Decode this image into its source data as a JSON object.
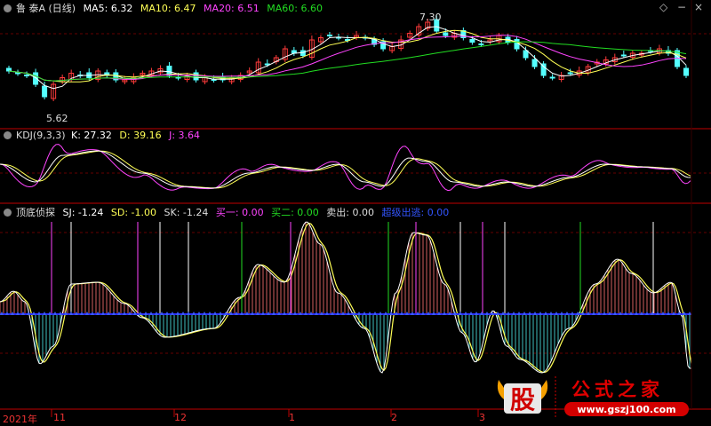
{
  "main_header": {
    "symbol": "鲁 泰A (日线)",
    "ma5": "MA5: 6.32",
    "ma10": "MA10: 6.47",
    "ma20": "MA20: 6.51",
    "ma60": "MA60: 6.60"
  },
  "kdj_header": {
    "name": "KDJ(9,3,3)",
    "k": "K: 27.32",
    "d": "D: 39.16",
    "j": "J: 3.64"
  },
  "detect_header": {
    "name": "顶底侦探",
    "sj": "SJ: -1.24",
    "sd": "SD: -1.00",
    "sk": "SK: -1.24",
    "buy1": "买一: 0.00",
    "buy2": "买二: 0.00",
    "sell": "卖出: 0.00",
    "escape": "超级出逃: 0.00"
  },
  "annotations": {
    "high": "7.30",
    "low": "5.62"
  },
  "x_axis": [
    "2021年",
    "11",
    "12",
    "1",
    "2",
    "3"
  ],
  "controls": {
    "diamond": "◇",
    "minus": "−",
    "close": "×"
  },
  "colors": {
    "up": "#ff3b3b",
    "down": "#54ffff",
    "ma5": "#ffffff",
    "ma10": "#ffff55",
    "ma20": "#ff44ff",
    "ma60": "#22dd22",
    "k": "#ffffff",
    "d": "#ffff55",
    "j": "#ff44ff",
    "border": "#c00000",
    "zero": "#2a2aff"
  },
  "logo": {
    "text1": "股",
    "text2": "公式之家",
    "url": "www.gszj100.com"
  },
  "chart_data": [
    {
      "type": "candlestick",
      "title": "鲁泰A (日线)",
      "series_names": [
        "MA5",
        "MA10",
        "MA20",
        "MA60"
      ],
      "ylim": [
        5.2,
        7.5
      ],
      "high_mark": 7.3,
      "low_mark": 5.62,
      "close_path": [
        6.2,
        6.15,
        6.1,
        5.9,
        5.62,
        5.9,
        6.05,
        6.15,
        6.1,
        6.05,
        6.2,
        6.1,
        6.0,
        6.0,
        6.05,
        6.15,
        6.2,
        6.25,
        6.1,
        6.05,
        6.1,
        6.0,
        6.05,
        6.0,
        6.0,
        6.05,
        6.1,
        6.2,
        6.4,
        6.35,
        6.5,
        6.7,
        6.6,
        6.55,
        6.9,
        6.95,
        7.0,
        6.95,
        6.9,
        7.0,
        6.95,
        6.8,
        6.7,
        6.75,
        6.9,
        7.05,
        7.2,
        7.3,
        7.1,
        7.0,
        7.05,
        6.95,
        6.85,
        6.8,
        6.9,
        7.0,
        6.85,
        6.7,
        6.5,
        6.3,
        6.1,
        6.05,
        6.1,
        6.15,
        6.2,
        6.3,
        6.4,
        6.45,
        6.5,
        6.55,
        6.6,
        6.6,
        6.65,
        6.7,
        6.6,
        6.3,
        6.1
      ]
    },
    {
      "type": "line",
      "title": "KDJ(9,3,3)",
      "series": [
        {
          "name": "K",
          "last": 27.32
        },
        {
          "name": "D",
          "last": 39.16
        },
        {
          "name": "J",
          "last": 3.64
        }
      ]
    },
    {
      "type": "bar",
      "title": "顶底侦探",
      "series": [
        {
          "name": "SJ",
          "last": -1.24
        },
        {
          "name": "SD",
          "last": -1.0
        },
        {
          "name": "SK",
          "last": -1.24
        }
      ]
    }
  ]
}
